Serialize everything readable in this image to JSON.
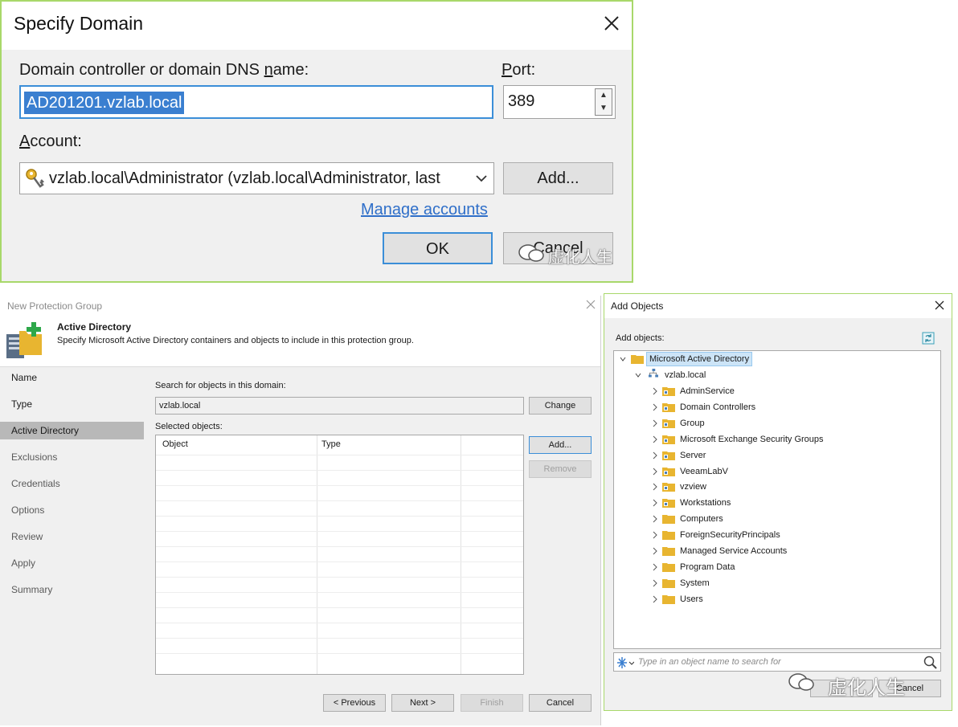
{
  "specify_domain": {
    "title": "Specify Domain",
    "domain_label_pre": "Domain controller or domain DNS ",
    "domain_label_ul": "n",
    "domain_label_post": "ame:",
    "domain_value": "AD201201.vzlab.local",
    "port_label_ul": "P",
    "port_label_post": "ort:",
    "port_value": "389",
    "account_label_ul": "A",
    "account_label_post": "ccount:",
    "account_value": "vzlab.local\\Administrator (vzlab.local\\Administrator, last",
    "add_button": "Add...",
    "manage_accounts_link": "Manage accounts",
    "ok_button": "OK",
    "cancel_button": "Cancel",
    "watermark": "虚化人生"
  },
  "protection_group": {
    "window_title": "New Protection Group",
    "header_title": "Active Directory",
    "header_subtitle": "Specify Microsoft Active Directory containers and objects to include in this protection group.",
    "nav_items": [
      {
        "label": "Name"
      },
      {
        "label": "Type"
      },
      {
        "label": "Active Directory"
      },
      {
        "label": "Exclusions"
      },
      {
        "label": "Credentials"
      },
      {
        "label": "Options"
      },
      {
        "label": "Review"
      },
      {
        "label": "Apply"
      },
      {
        "label": "Summary"
      }
    ],
    "current_step": "Active Directory",
    "search_domain_label": "Search for objects in this domain:",
    "search_domain_value": "vzlab.local",
    "change_button": "Change",
    "selected_objects_label": "Selected objects:",
    "columns": [
      "Object",
      "Type"
    ],
    "add_button": "Add...",
    "remove_button": "Remove",
    "previous_button": "< Previous",
    "next_button": "Next >",
    "finish_button": "Finish",
    "cancel_button": "Cancel"
  },
  "add_objects": {
    "title": "Add Objects",
    "add_objects_label": "Add objects:",
    "root_label": "Microsoft Active Directory",
    "domain_label": "vzlab.local",
    "ou_items": [
      {
        "label": "AdminService",
        "type": "ou"
      },
      {
        "label": "Domain Controllers",
        "type": "ou"
      },
      {
        "label": "Group",
        "type": "ou"
      },
      {
        "label": "Microsoft Exchange Security Groups",
        "type": "ou"
      },
      {
        "label": "Server",
        "type": "ou"
      },
      {
        "label": "VeeamLabV",
        "type": "ou"
      },
      {
        "label": "vzview",
        "type": "ou"
      },
      {
        "label": "Workstations",
        "type": "ou"
      },
      {
        "label": "Computers",
        "type": "container"
      },
      {
        "label": "ForeignSecurityPrincipals",
        "type": "container"
      },
      {
        "label": "Managed Service Accounts",
        "type": "container"
      },
      {
        "label": "Program Data",
        "type": "container"
      },
      {
        "label": "System",
        "type": "container"
      },
      {
        "label": "Users",
        "type": "container"
      }
    ],
    "search_placeholder": "Type in an object name to search for",
    "cancel_button": "Cancel",
    "watermark": "虚化人生"
  },
  "colors": {
    "accent_border": "#a8d86a",
    "selection_blue": "#3a7fd0",
    "link_blue": "#2f6fc9",
    "folder_yellow": "#e8b530"
  }
}
